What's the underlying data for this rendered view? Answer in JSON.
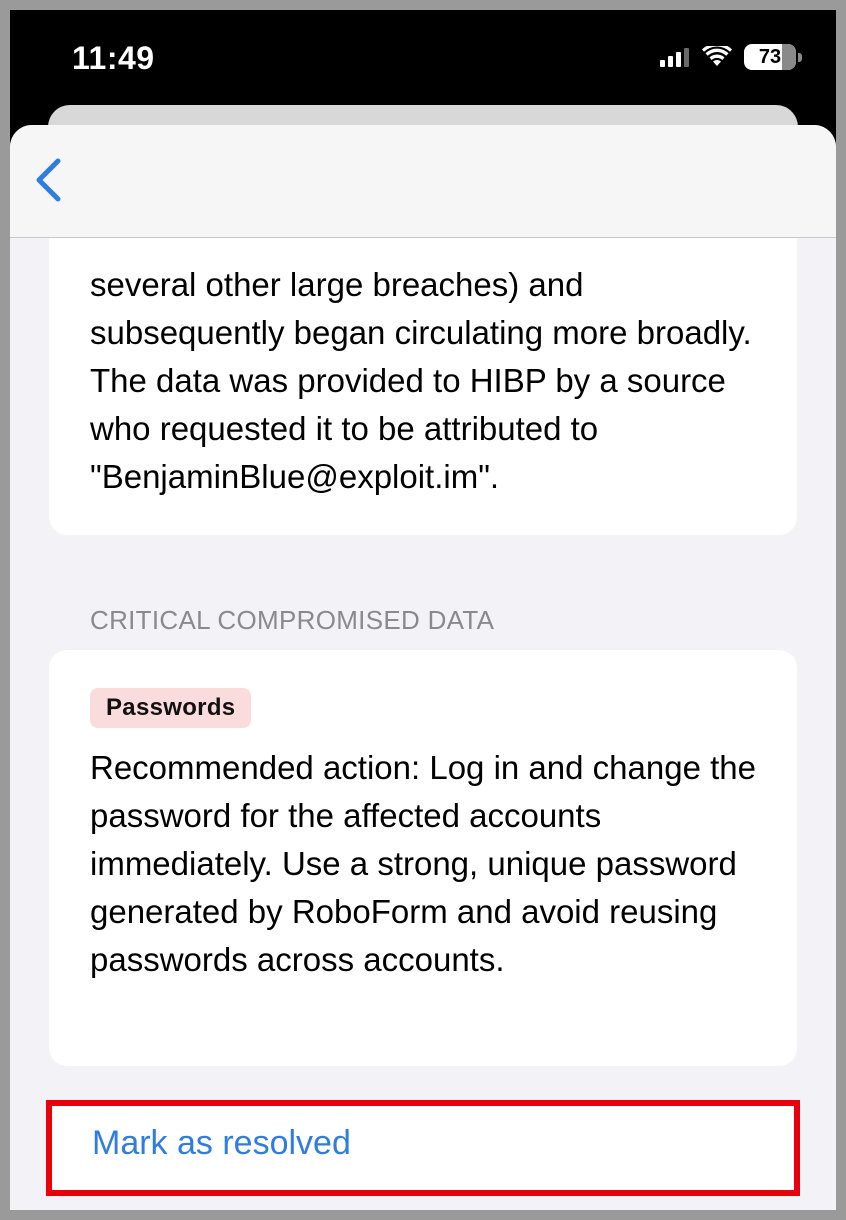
{
  "status_bar": {
    "time": "11:49",
    "battery": "73",
    "icons": [
      "signal-icon",
      "wifi-icon",
      "battery-icon"
    ]
  },
  "nav": {
    "back_icon": "chevron-left-icon"
  },
  "breach": {
    "description_visible": "several other large breaches) and subsequently began circulating more broadly. The data was provided to HIBP by a source who requested it to be attributed to \"BenjaminBlue@exploit.im\"."
  },
  "critical": {
    "section_label": "CRITICAL COMPROMISED DATA",
    "badge": "Passwords",
    "recommended_action": "Recommended action: Log in and change the password for the affected accounts immediately. Use a strong, unique password generated by RoboForm and avoid reusing passwords across accounts."
  },
  "actions": {
    "mark_resolved": "Mark as resolved"
  },
  "colors": {
    "accent": "#2f7de1",
    "highlight_border": "#e8000b",
    "badge_bg": "#fadcdc",
    "sheet_bg": "#f2f2f7"
  }
}
